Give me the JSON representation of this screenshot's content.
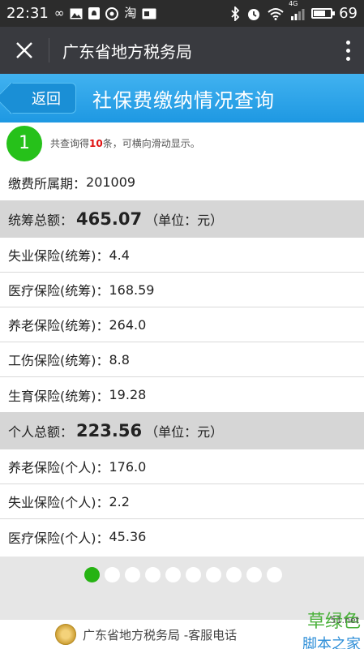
{
  "status_bar": {
    "time": "22:31",
    "left_icons": [
      "infinity-icon",
      "image-icon",
      "notification-icon",
      "app-icon",
      "taobao-icon",
      "sim-card-icon"
    ],
    "right_icons": [
      "bluetooth-icon",
      "alarm-icon",
      "wifi-icon",
      "signal-icon",
      "battery-icon"
    ],
    "signal_label": "4G",
    "battery": "69",
    "battery_level": 0.69
  },
  "wechat_bar": {
    "title": "广东省地方税务局"
  },
  "header": {
    "back_label": "返回",
    "title": "社保费缴纳情况查询"
  },
  "summary": {
    "index": "1",
    "text_prefix": "共查询得",
    "count": "10",
    "text_suffix": "条，可横向滑动显示。"
  },
  "period": {
    "label": "缴费所属期：",
    "value": "201009"
  },
  "pooled_total": {
    "label": "统筹总额：",
    "amount": "465.07",
    "unit": "（单位：元）"
  },
  "pooled_items": [
    {
      "label": "失业保险(统筹)：",
      "value": "4.4"
    },
    {
      "label": "医疗保险(统筹)：",
      "value": "168.59"
    },
    {
      "label": "养老保险(统筹)：",
      "value": "264.0"
    },
    {
      "label": "工伤保险(统筹)：",
      "value": "8.8"
    },
    {
      "label": "生育保险(统筹)：",
      "value": "19.28"
    }
  ],
  "personal_total": {
    "label": "个人总额：",
    "amount": "223.56",
    "unit": "（单位：元）"
  },
  "personal_items": [
    {
      "label": "养老保险(个人)：",
      "value": "176.0"
    },
    {
      "label": "失业保险(个人)：",
      "value": "2.2"
    },
    {
      "label": "医疗保险(个人)：",
      "value": "45.36"
    }
  ],
  "pager": {
    "total_pages": 10,
    "current_page": 1
  },
  "footer": {
    "text": "广东省地方税务局 -客服电话"
  },
  "watermark": {
    "main": "草绿色",
    "sub": "脚本之家",
    "url": "51.net"
  },
  "colors": {
    "header_blue": "#2aa3e9",
    "accent_green": "#26c11a",
    "count_red": "#e01010"
  }
}
